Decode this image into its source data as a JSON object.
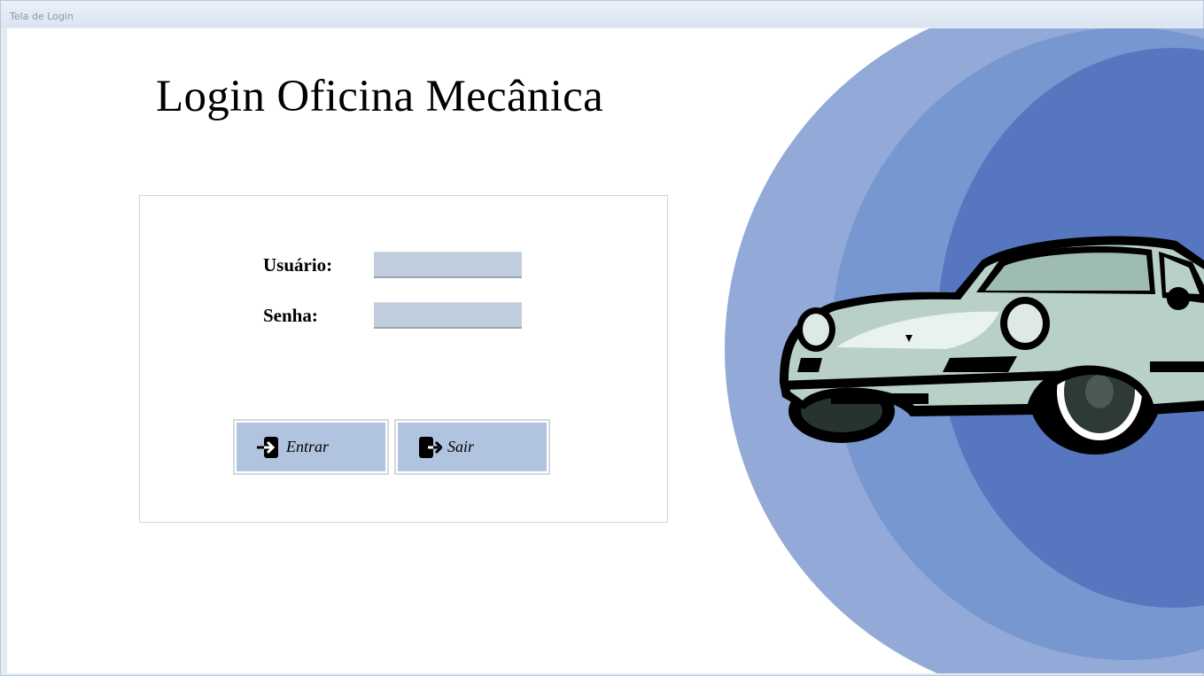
{
  "window": {
    "title": "Tela de Login"
  },
  "page": {
    "title": "Login Oficina Mecânica"
  },
  "form": {
    "username_label": "Usuário:",
    "username_value": "",
    "password_label": "Senha:",
    "password_value": ""
  },
  "buttons": {
    "enter_label": "Entrar",
    "enter_icon": "login-icon",
    "exit_label": "Sair",
    "exit_icon": "logout-icon"
  },
  "colors": {
    "button_bg": "#b0c4df",
    "input_bg": "#bfcddc",
    "arc_outer": "#93aad8",
    "arc_middle": "#7797d0",
    "arc_inner": "#5677bf",
    "car_body": "#b8d0c6"
  }
}
